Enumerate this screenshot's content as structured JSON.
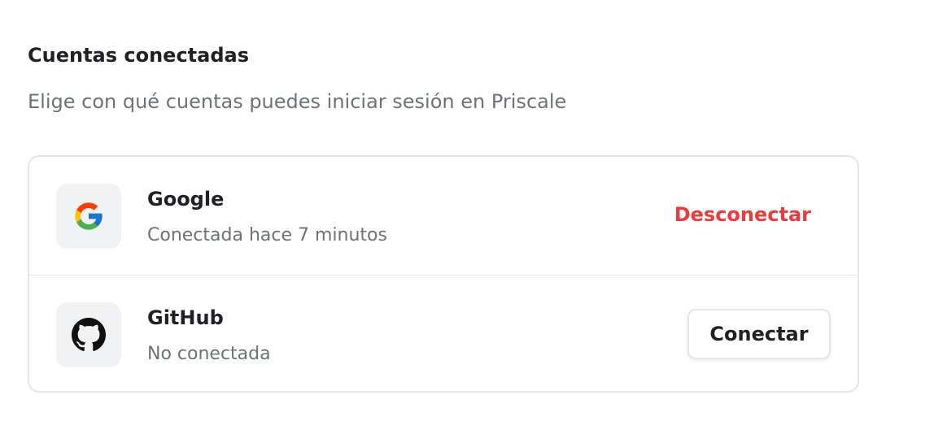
{
  "section": {
    "title": "Cuentas conectadas",
    "subtitle": "Elige con qué cuentas puedes iniciar sesión en Priscale"
  },
  "accounts": [
    {
      "name": "Google",
      "icon": "google-icon",
      "status": "Conectada hace 7 minutos",
      "action_label": "Desconectar",
      "action_color": "#ef3a3a"
    },
    {
      "name": "GitHub",
      "icon": "github-icon",
      "status": "No conectada",
      "action_label": "Conectar"
    }
  ],
  "colors": {
    "text_primary": "#1f2124",
    "text_secondary": "#6a7378",
    "danger": "#ef3a3a",
    "border": "#e3e5e8",
    "icon_bg": "#f1f2f3"
  }
}
